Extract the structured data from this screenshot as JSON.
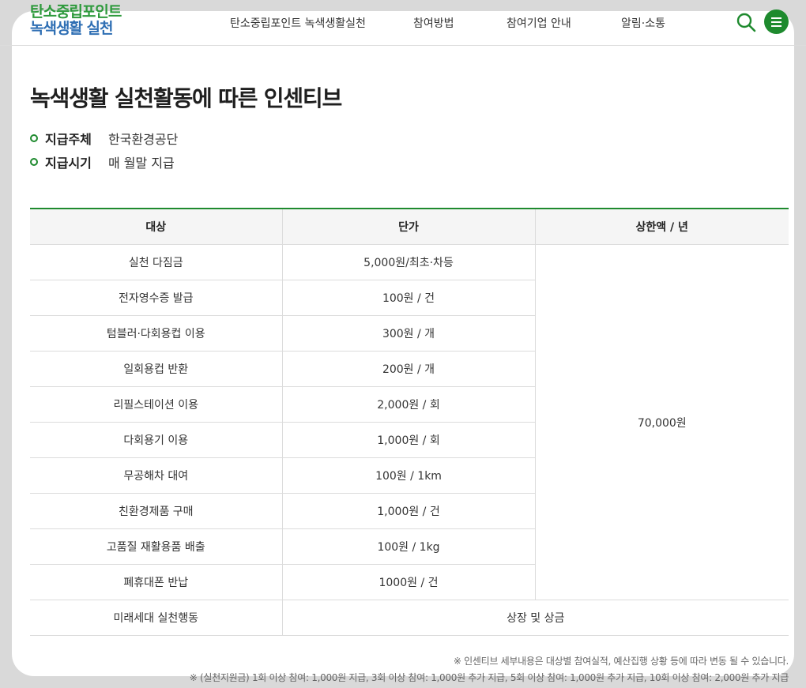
{
  "logo": {
    "line1": "탄소중립포인트",
    "line2": "녹색생활 실천"
  },
  "nav": [
    {
      "label": "탄소중립포인트 녹색생활실천"
    },
    {
      "label": "참여방법"
    },
    {
      "label": "참여기업 안내"
    },
    {
      "label": "알림·소통"
    }
  ],
  "icons": {
    "search": "search-icon",
    "menu": "hamburger-menu-icon"
  },
  "colors": {
    "accent": "#1e8a2e",
    "logo_green": "#2e9a3c",
    "logo_blue": "#2f6fb4"
  },
  "page": {
    "title": "녹색생활 실천활동에 따른 인센티브",
    "info": [
      {
        "key": "지급주체",
        "value": "한국환경공단"
      },
      {
        "key": "지급시기",
        "value": "매 월말 지급"
      }
    ]
  },
  "table": {
    "headers": [
      "대상",
      "단가",
      "상한액 / 년"
    ],
    "rows": [
      {
        "target": "실천 다짐금",
        "price": "5,000원/최초·차등"
      },
      {
        "target": "전자영수증 발급",
        "price": "100원 / 건"
      },
      {
        "target": "텀블러·다회용컵 이용",
        "price": "300원 / 개"
      },
      {
        "target": "일회용컵 반환",
        "price": "200원 / 개"
      },
      {
        "target": "리필스테이션 이용",
        "price": "2,000원 / 회"
      },
      {
        "target": "다회용기 이용",
        "price": "1,000원 / 회"
      },
      {
        "target": "무공해차 대여",
        "price": "100원 / 1km"
      },
      {
        "target": "친환경제품 구매",
        "price": "1,000원 / 건"
      },
      {
        "target": "고품질 재활용품 배출",
        "price": "100원 / 1kg"
      },
      {
        "target": "폐휴대폰 반납",
        "price": "1000원 / 건"
      }
    ],
    "cap": "70,000원",
    "last_row": {
      "target": "미래세대 실천행동",
      "price": "상장 및 상금"
    }
  },
  "notes": [
    "※ 인센티브 세부내용은 대상별 참여실적, 예산집행 상황 등에 따라 변동 될 수 있습니다.",
    "※ (실천지원금) 1회 이상 참여: 1,000원 지급, 3회 이상 참여: 1,000원 추가 지급, 5회 이상 참여: 1,000원 추가 지급, 10회 이상 참여: 2,000원 추가 지급"
  ]
}
